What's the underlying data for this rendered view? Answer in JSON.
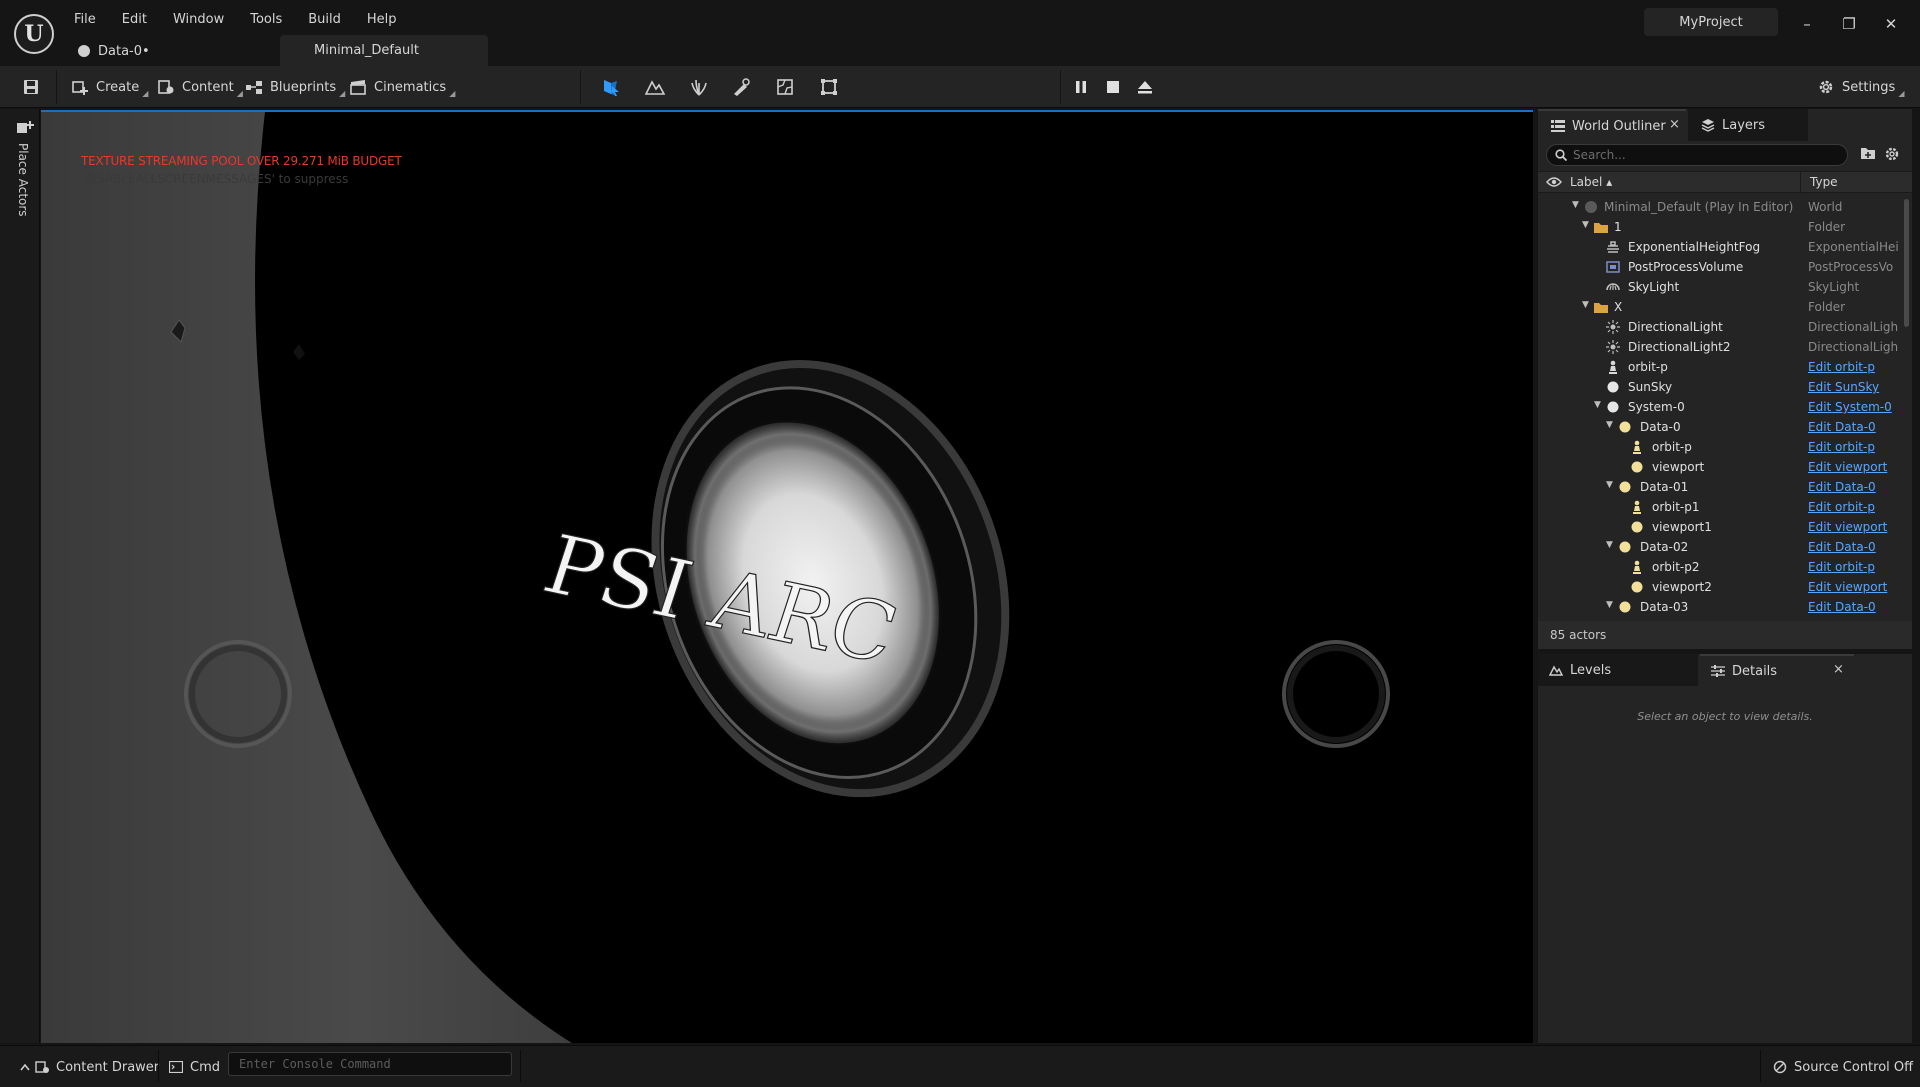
{
  "app": {
    "logo_text": "U",
    "menu": [
      "File",
      "Edit",
      "Window",
      "Tools",
      "Build",
      "Help"
    ],
    "project_name": "MyProject",
    "document_tab": "Data-0•",
    "level_tab": "Minimal_Default",
    "window_controls": {
      "minimize": "–",
      "restore": "❐",
      "close": "✕"
    }
  },
  "toolbar": {
    "save_icon": "save-icon",
    "create": "Create",
    "content": "Content",
    "blueprints": "Blueprints",
    "cinematics": "Cinematics",
    "settings": "Settings",
    "modes": [
      "select-mode-icon",
      "landscape-mode-icon",
      "foliage-mode-icon",
      "mesh-paint-mode-icon",
      "fracture-mode-icon",
      "modeling-mode-icon"
    ],
    "play_controls": [
      "pause-icon",
      "stop-icon",
      "eject-icon"
    ]
  },
  "left_strip": {
    "place_actors": "Place Actors"
  },
  "viewport": {
    "warning": "TEXTURE STREAMING POOL OVER 29.271 MiB BUDGET",
    "hint": "'DISABLEALLSCREENMESSAGES' to suppress",
    "logo_text": "PSI ARC",
    "warning_color": "#e43a2a",
    "selection_accent": "#1e6fbf"
  },
  "outliner": {
    "tab_label": "World Outliner",
    "layers_tab": "Layers",
    "close": "×",
    "search_placeholder": "Search...",
    "col_label": "Label ▴",
    "col_type": "Type",
    "rows": [
      {
        "label": "Minimal_Default (Play In Editor)",
        "type": "World",
        "link": false,
        "dim": true
      },
      {
        "label": "1",
        "type": "Folder",
        "link": false
      },
      {
        "label": "ExponentialHeightFog",
        "type": "ExponentialHeig",
        "link": false
      },
      {
        "label": "PostProcessVolume",
        "type": "PostProcessVo",
        "link": false
      },
      {
        "label": "SkyLight",
        "type": "SkyLight",
        "link": false
      },
      {
        "label": "X",
        "type": "Folder",
        "link": false
      },
      {
        "label": "DirectionalLight",
        "type": "DirectionalLight",
        "link": false
      },
      {
        "label": "DirectionalLight2",
        "type": "DirectionalLight",
        "link": false
      },
      {
        "label": "orbit-p",
        "type": "Edit orbit-p",
        "link": true
      },
      {
        "label": "SunSky",
        "type": "Edit SunSky",
        "link": true
      },
      {
        "label": "System-0",
        "type": "Edit System-0",
        "link": true
      },
      {
        "label": "Data-0",
        "type": "Edit Data-0",
        "link": true
      },
      {
        "label": "orbit-p",
        "type": "Edit orbit-p",
        "link": true
      },
      {
        "label": "viewport",
        "type": "Edit viewport",
        "link": true
      },
      {
        "label": "Data-01",
        "type": "Edit Data-0",
        "link": true
      },
      {
        "label": "orbit-p1",
        "type": "Edit orbit-p",
        "link": true
      },
      {
        "label": "viewport1",
        "type": "Edit viewport",
        "link": true
      },
      {
        "label": "Data-02",
        "type": "Edit Data-0",
        "link": true
      },
      {
        "label": "orbit-p2",
        "type": "Edit orbit-p",
        "link": true
      },
      {
        "label": "viewport2",
        "type": "Edit viewport",
        "link": true
      },
      {
        "label": "Data-03",
        "type": "Edit Data-0",
        "link": true
      }
    ],
    "actor_count": "85 actors",
    "link_color": "#5aa6ff"
  },
  "details": {
    "levels_tab": "Levels",
    "details_tab": "Details",
    "close": "×",
    "empty_message": "Select an object to view details."
  },
  "statusbar": {
    "content_drawer": "Content Drawer",
    "cmd": "Cmd",
    "console_placeholder": "Enter Console Command",
    "source_control": "Source Control Off"
  }
}
